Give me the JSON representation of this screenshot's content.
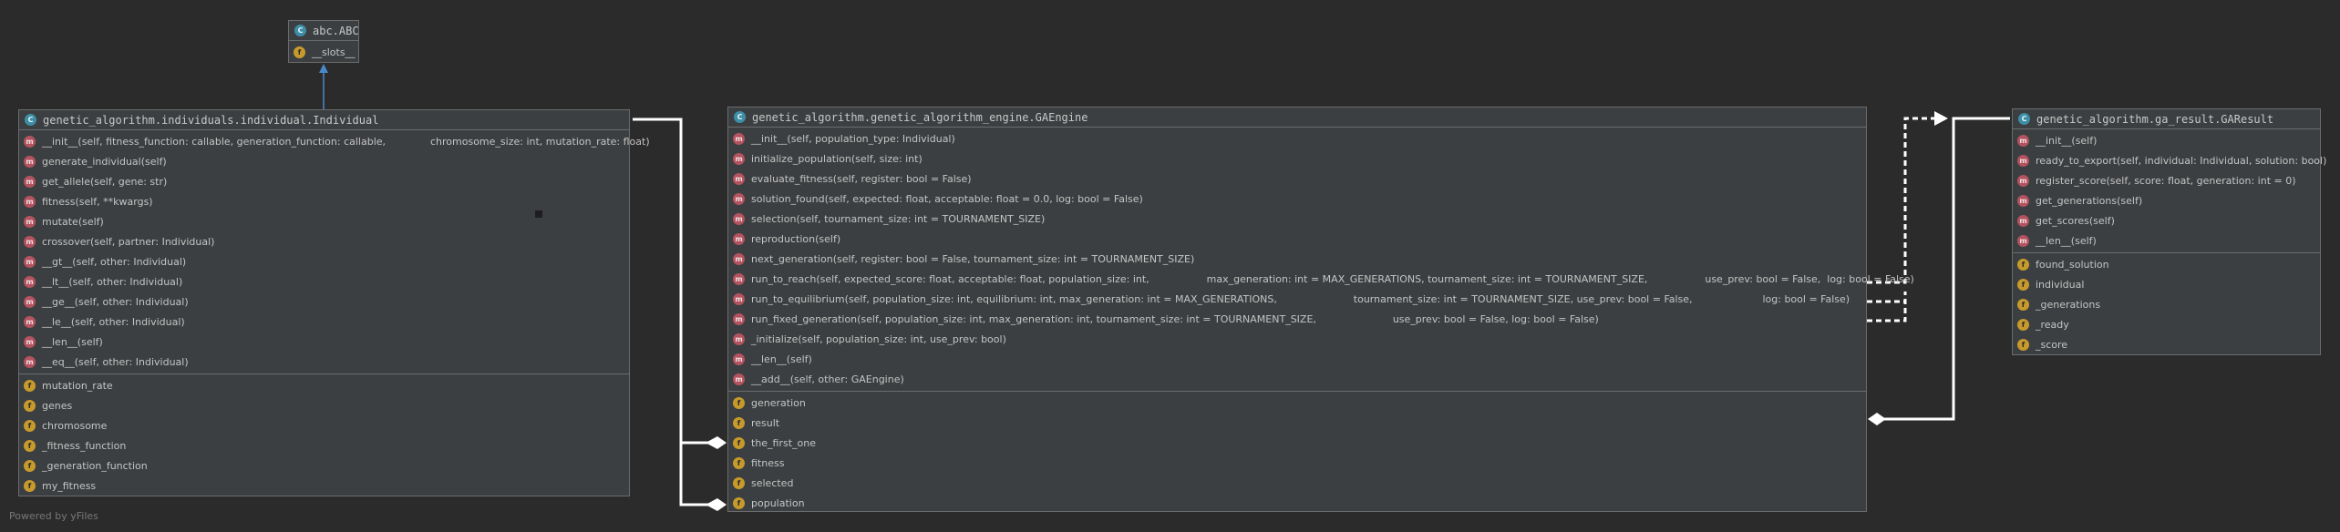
{
  "classes": {
    "abc": {
      "name": "abc.ABC",
      "fields": [
        "__slots__"
      ]
    },
    "individual": {
      "name": "genetic_algorithm.individuals.individual.Individual",
      "methods": [
        "__init__(self, fitness_function: callable, generation_function: callable,              chromosome_size: int, mutation_rate: float)",
        "generate_individual(self)",
        "get_allele(self, gene: str)",
        "fitness(self, **kwargs)",
        "mutate(self)",
        "crossover(self, partner: Individual)",
        "__gt__(self, other: Individual)",
        "__lt__(self, other: Individual)",
        "__ge__(self, other: Individual)",
        "__le__(self, other: Individual)",
        "__len__(self)",
        "__eq__(self, other: Individual)"
      ],
      "fields": [
        "mutation_rate",
        "genes",
        "chromosome",
        "_fitness_function",
        "_generation_function",
        "my_fitness"
      ]
    },
    "engine": {
      "name": "genetic_algorithm.genetic_algorithm_engine.GAEngine",
      "methods": [
        "__init__(self, population_type: Individual)",
        "initialize_population(self, size: int)",
        "evaluate_fitness(self, register: bool = False)",
        "solution_found(self, expected: float, acceptable: float = 0.0, log: bool = False)",
        "selection(self, tournament_size: int = TOURNAMENT_SIZE)",
        "reproduction(self)",
        "next_generation(self, register: bool = False, tournament_size: int = TOURNAMENT_SIZE)",
        "run_to_reach(self, expected_score: float, acceptable: float, population_size: int,                  max_generation: int = MAX_GENERATIONS, tournament_size: int = TOURNAMENT_SIZE,                  use_prev: bool = False,  log: bool = False)",
        "run_to_equilibrium(self, population_size: int, equilibrium: int, max_generation: int = MAX_GENERATIONS,                        tournament_size: int = TOURNAMENT_SIZE, use_prev: bool = False,                      log: bool = False)",
        "run_fixed_generation(self, population_size: int, max_generation: int, tournament_size: int = TOURNAMENT_SIZE,                        use_prev: bool = False, log: bool = False)",
        "_initialize(self, population_size: int, use_prev: bool)",
        "__len__(self)",
        "__add__(self, other: GAEngine)"
      ],
      "fields": [
        "generation",
        "result",
        "the_first_one",
        "fitness",
        "selected",
        "population"
      ]
    },
    "result": {
      "name": "genetic_algorithm.ga_result.GAResult",
      "methods": [
        "__init__(self)",
        "ready_to_export(self, individual: Individual, solution: bool)",
        "register_score(self, score: float, generation: int = 0)",
        "get_generations(self)",
        "get_scores(self)",
        "__len__(self)"
      ],
      "fields": [
        "found_solution",
        "individual",
        "_generations",
        "_ready",
        "_score"
      ]
    }
  },
  "icons": {
    "class": "C",
    "method": "m",
    "field": "f"
  },
  "colors": {
    "background": "#2b2b2b",
    "node": "#3c3f41",
    "class_icon": "#3e8ea6",
    "method_icon": "#b3535f",
    "field_icon": "#c79a2c",
    "inheritance_edge": "#4a88c7",
    "edge": "#ffffff"
  },
  "footer": "Powered by yFiles"
}
